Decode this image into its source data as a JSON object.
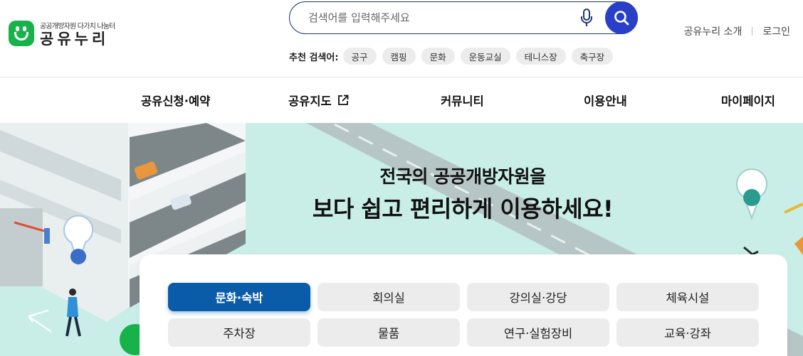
{
  "logo": {
    "subtitle": "공공개방자원 다가치 나눔터",
    "name": "공유누리"
  },
  "search": {
    "placeholder": "검색어를 입력해주세요",
    "value": ""
  },
  "recommend": {
    "label": "추천 검색어:",
    "chips": [
      "공구",
      "캠핑",
      "문화",
      "운동교실",
      "테니스장",
      "축구장"
    ]
  },
  "util": {
    "about": "공유누리 소개",
    "login": "로그인"
  },
  "gnb": {
    "items": [
      "공유신청·예약",
      "공유지도",
      "커뮤니티",
      "이용안내",
      "마이페이지"
    ]
  },
  "hero": {
    "line1": "전국의 공공개방자원을",
    "line2": "보다 쉽고 편리하게 이용하세요!"
  },
  "categories": {
    "items": [
      "문화·숙박",
      "회의실",
      "강의실·강당",
      "체육시설",
      "주차장",
      "물품",
      "연구·실험장비",
      "교육·강좌"
    ],
    "selected": "문화·숙박"
  },
  "colors": {
    "accent": "#2a3fc8",
    "brand_green": "#17b34a",
    "active_category": "#0a5ca8",
    "hero_bg": "#c9eee8"
  },
  "icons": {
    "mic": "microphone-icon",
    "search": "search-icon",
    "external": "external-link-icon"
  }
}
